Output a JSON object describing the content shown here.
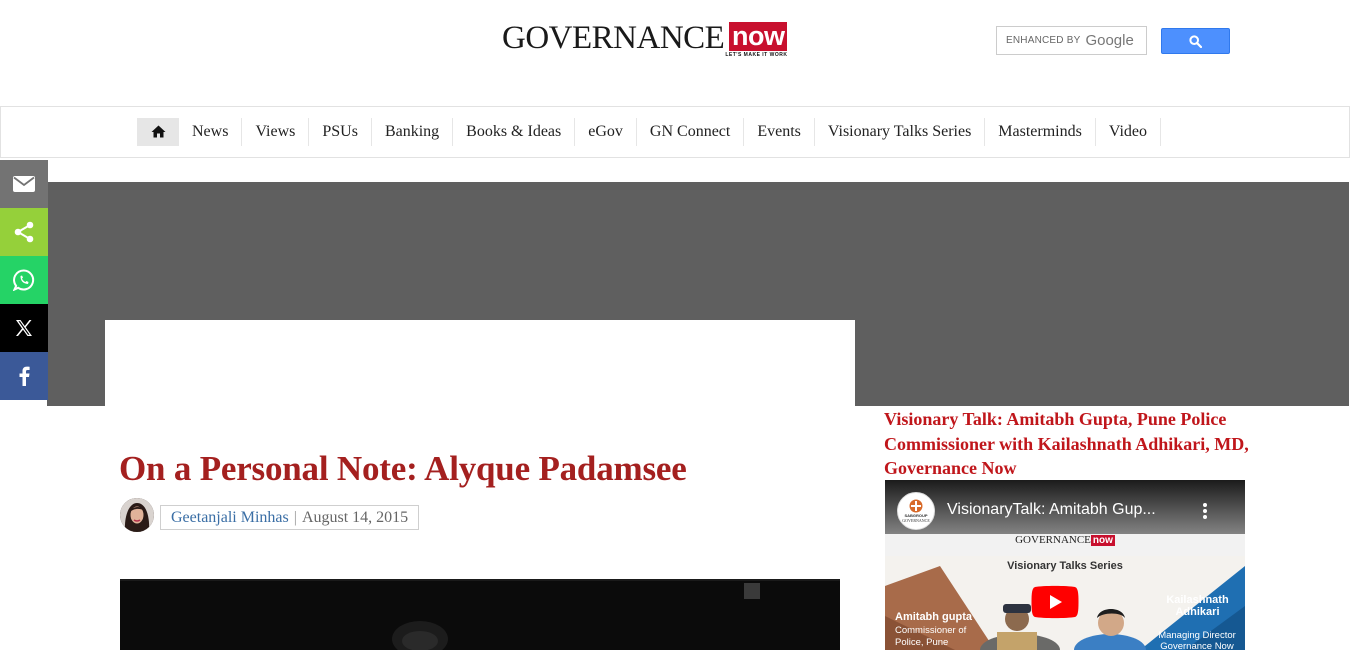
{
  "brand": {
    "name": "GOVERNANCE",
    "accent": "now",
    "tagline": "LET'S MAKE IT WORK",
    "accent_color": "#c8102e"
  },
  "search": {
    "enhanced_label": "ENHANCED BY",
    "provider": "Google",
    "placeholder": "",
    "button_icon": "search-icon"
  },
  "nav": {
    "home_icon": "home-icon",
    "items": [
      "News",
      "Views",
      "PSUs",
      "Banking",
      "Books & Ideas",
      "eGov",
      "GN Connect",
      "Events",
      "Visionary Talks Series",
      "Masterminds",
      "Video"
    ]
  },
  "share": {
    "items": [
      {
        "icon": "email-icon",
        "color": "#737373"
      },
      {
        "icon": "share-icon",
        "color": "#95d03a"
      },
      {
        "icon": "whatsapp-icon",
        "color": "#25d366"
      },
      {
        "icon": "x-icon",
        "color": "#000000"
      },
      {
        "icon": "facebook-icon",
        "color": "#3b5998"
      }
    ]
  },
  "article": {
    "title": "On a Personal Note: Alyque Padamsee",
    "author": "Geetanjali Minhas",
    "separator": "|",
    "date": "August 14, 2015"
  },
  "sidebar": {
    "title": "Visionary Talk: Amitabh Gupta, Pune Police Commissioner with Kailashnath Adhikari, MD, Governance Now",
    "video": {
      "title": "VisionaryTalk: Amitabh Gup...",
      "channel_top": "SABGROUP",
      "channel_bottom": "GOVERNANCE",
      "org_line": "GOVERNANCE",
      "org_accent": "now",
      "series": "Visionary Talks Series",
      "guest_name": "Amitabh gupta",
      "guest_role": "Commissioner of Police, Pune",
      "host_name": "Kailashnath Adhikari",
      "host_role": "Managing Director Governance Now"
    }
  }
}
